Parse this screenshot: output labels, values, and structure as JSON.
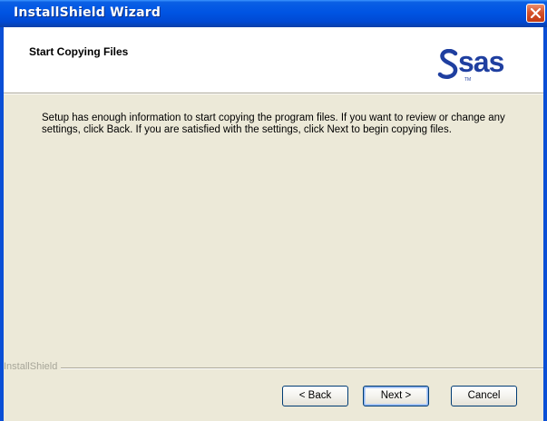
{
  "window": {
    "title": "InstallShield Wizard",
    "close_icon": "close-icon"
  },
  "header": {
    "title": "Start Copying Files",
    "logo": {
      "text": "sas",
      "trademark": "TM",
      "icon": "sas-logo-icon",
      "color": "#1f3fa0"
    }
  },
  "body": {
    "message": "Setup has enough information to start copying the program files.  If you want to review or change any settings, click Back.  If you are satisfied with the settings, click Next to begin copying files."
  },
  "footer": {
    "brand_label": "InstallShield",
    "buttons": {
      "back": "< Back",
      "next": "Next >",
      "cancel": "Cancel"
    }
  },
  "colors": {
    "titlebar": "#0054e3",
    "close": "#d6532c",
    "dialog_bg": "#ece9d8"
  }
}
